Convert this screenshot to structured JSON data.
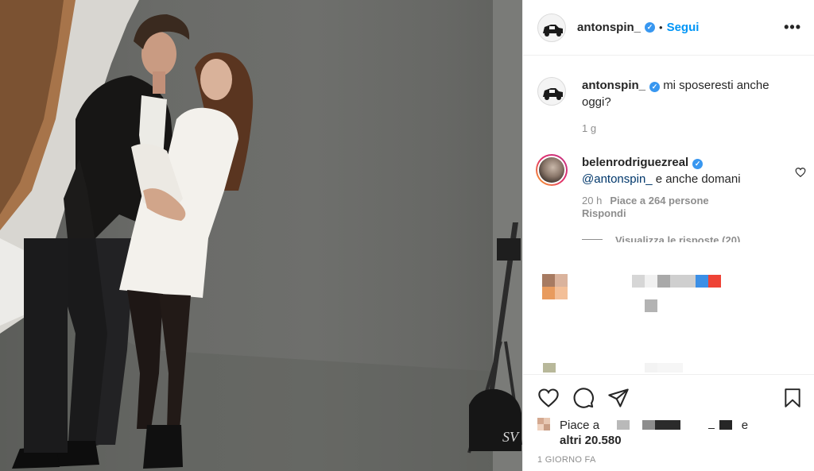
{
  "post": {
    "username": "antonspin_",
    "verified_mark": "✓",
    "dot": "•",
    "follow_label": "Segui",
    "more_label": "•••",
    "caption_text": "mi sposeresti anche oggi?",
    "caption_age": "1 g",
    "date_label": "1 GIORNO FA"
  },
  "comments": [
    {
      "username": "belenrodriguezreal",
      "mention": "@antonspin_",
      "text": " e anche domani",
      "time": "20 h",
      "likes_label": "Piace a 264 persone",
      "reply_label": "Rispondi",
      "view_replies_label": "Visualizza le risposte (20)"
    }
  ],
  "likes": {
    "prefix": "Piace a",
    "suffix": "e",
    "count_label": "altri 20.580"
  },
  "icons": {
    "like": "heart-icon",
    "comment": "comment-icon",
    "share": "paper-plane-icon",
    "save": "bookmark-icon",
    "comment_like": "heart-icon"
  },
  "colors": {
    "accent": "#0095f6",
    "verified": "#3897f0",
    "muted": "#8e8e8e",
    "text": "#262626"
  }
}
